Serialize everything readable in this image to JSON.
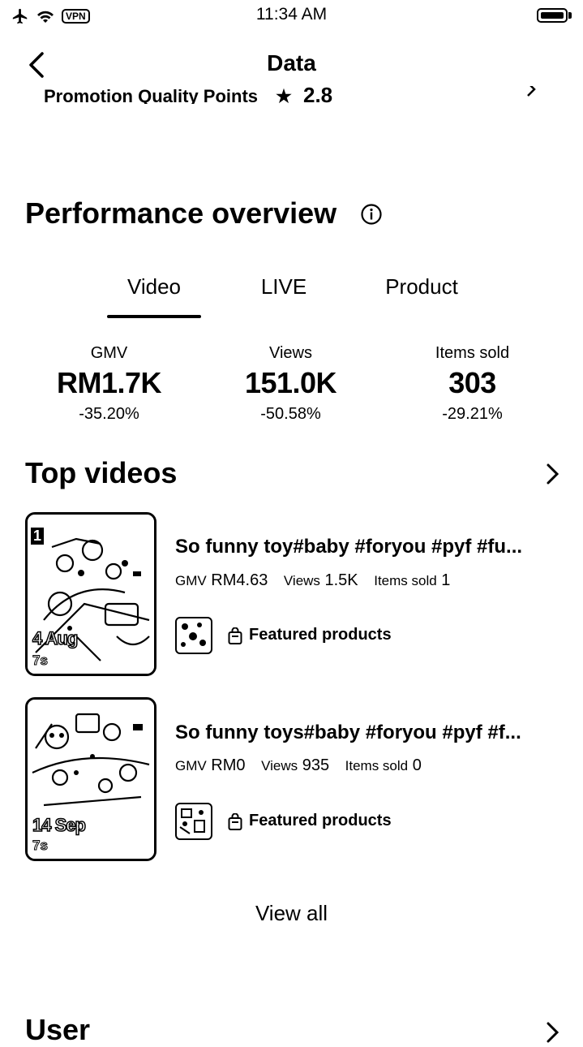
{
  "status_bar": {
    "vpn": "VPN",
    "time": "11:34 AM"
  },
  "nav": {
    "title": "Data"
  },
  "clipped_row": {
    "text": "Promotion Quality Points",
    "value": "2.8"
  },
  "performance": {
    "title": "Performance overview",
    "tabs": [
      "Video",
      "LIVE",
      "Product"
    ],
    "active_tab": "Video",
    "metrics": [
      {
        "label": "GMV",
        "value": "RM1.7K",
        "delta": "-35.20%"
      },
      {
        "label": "Views",
        "value": "151.0K",
        "delta": "-50.58%"
      },
      {
        "label": "Items sold",
        "value": "303",
        "delta": "-29.21%"
      }
    ]
  },
  "top_videos": {
    "title": "Top videos",
    "items": [
      {
        "title": "So funny toy#baby #foryou #pyf #fu...",
        "date": "4 Aug",
        "duration": "7s",
        "badge": "1",
        "gmv_label": "GMV",
        "gmv": "RM4.63",
        "views_label": "Views",
        "views": "1.5K",
        "sold_label": "Items sold",
        "sold": "1",
        "featured": "Featured products"
      },
      {
        "title": "So funny toys#baby #foryou #pyf #f...",
        "date": "14 Sep",
        "duration": "7s",
        "gmv_label": "GMV",
        "gmv": "RM0",
        "views_label": "Views",
        "views": "935",
        "sold_label": "Items sold",
        "sold": "0",
        "featured": "Featured products"
      }
    ],
    "view_all": "View all"
  },
  "user_section": {
    "title": "User"
  }
}
